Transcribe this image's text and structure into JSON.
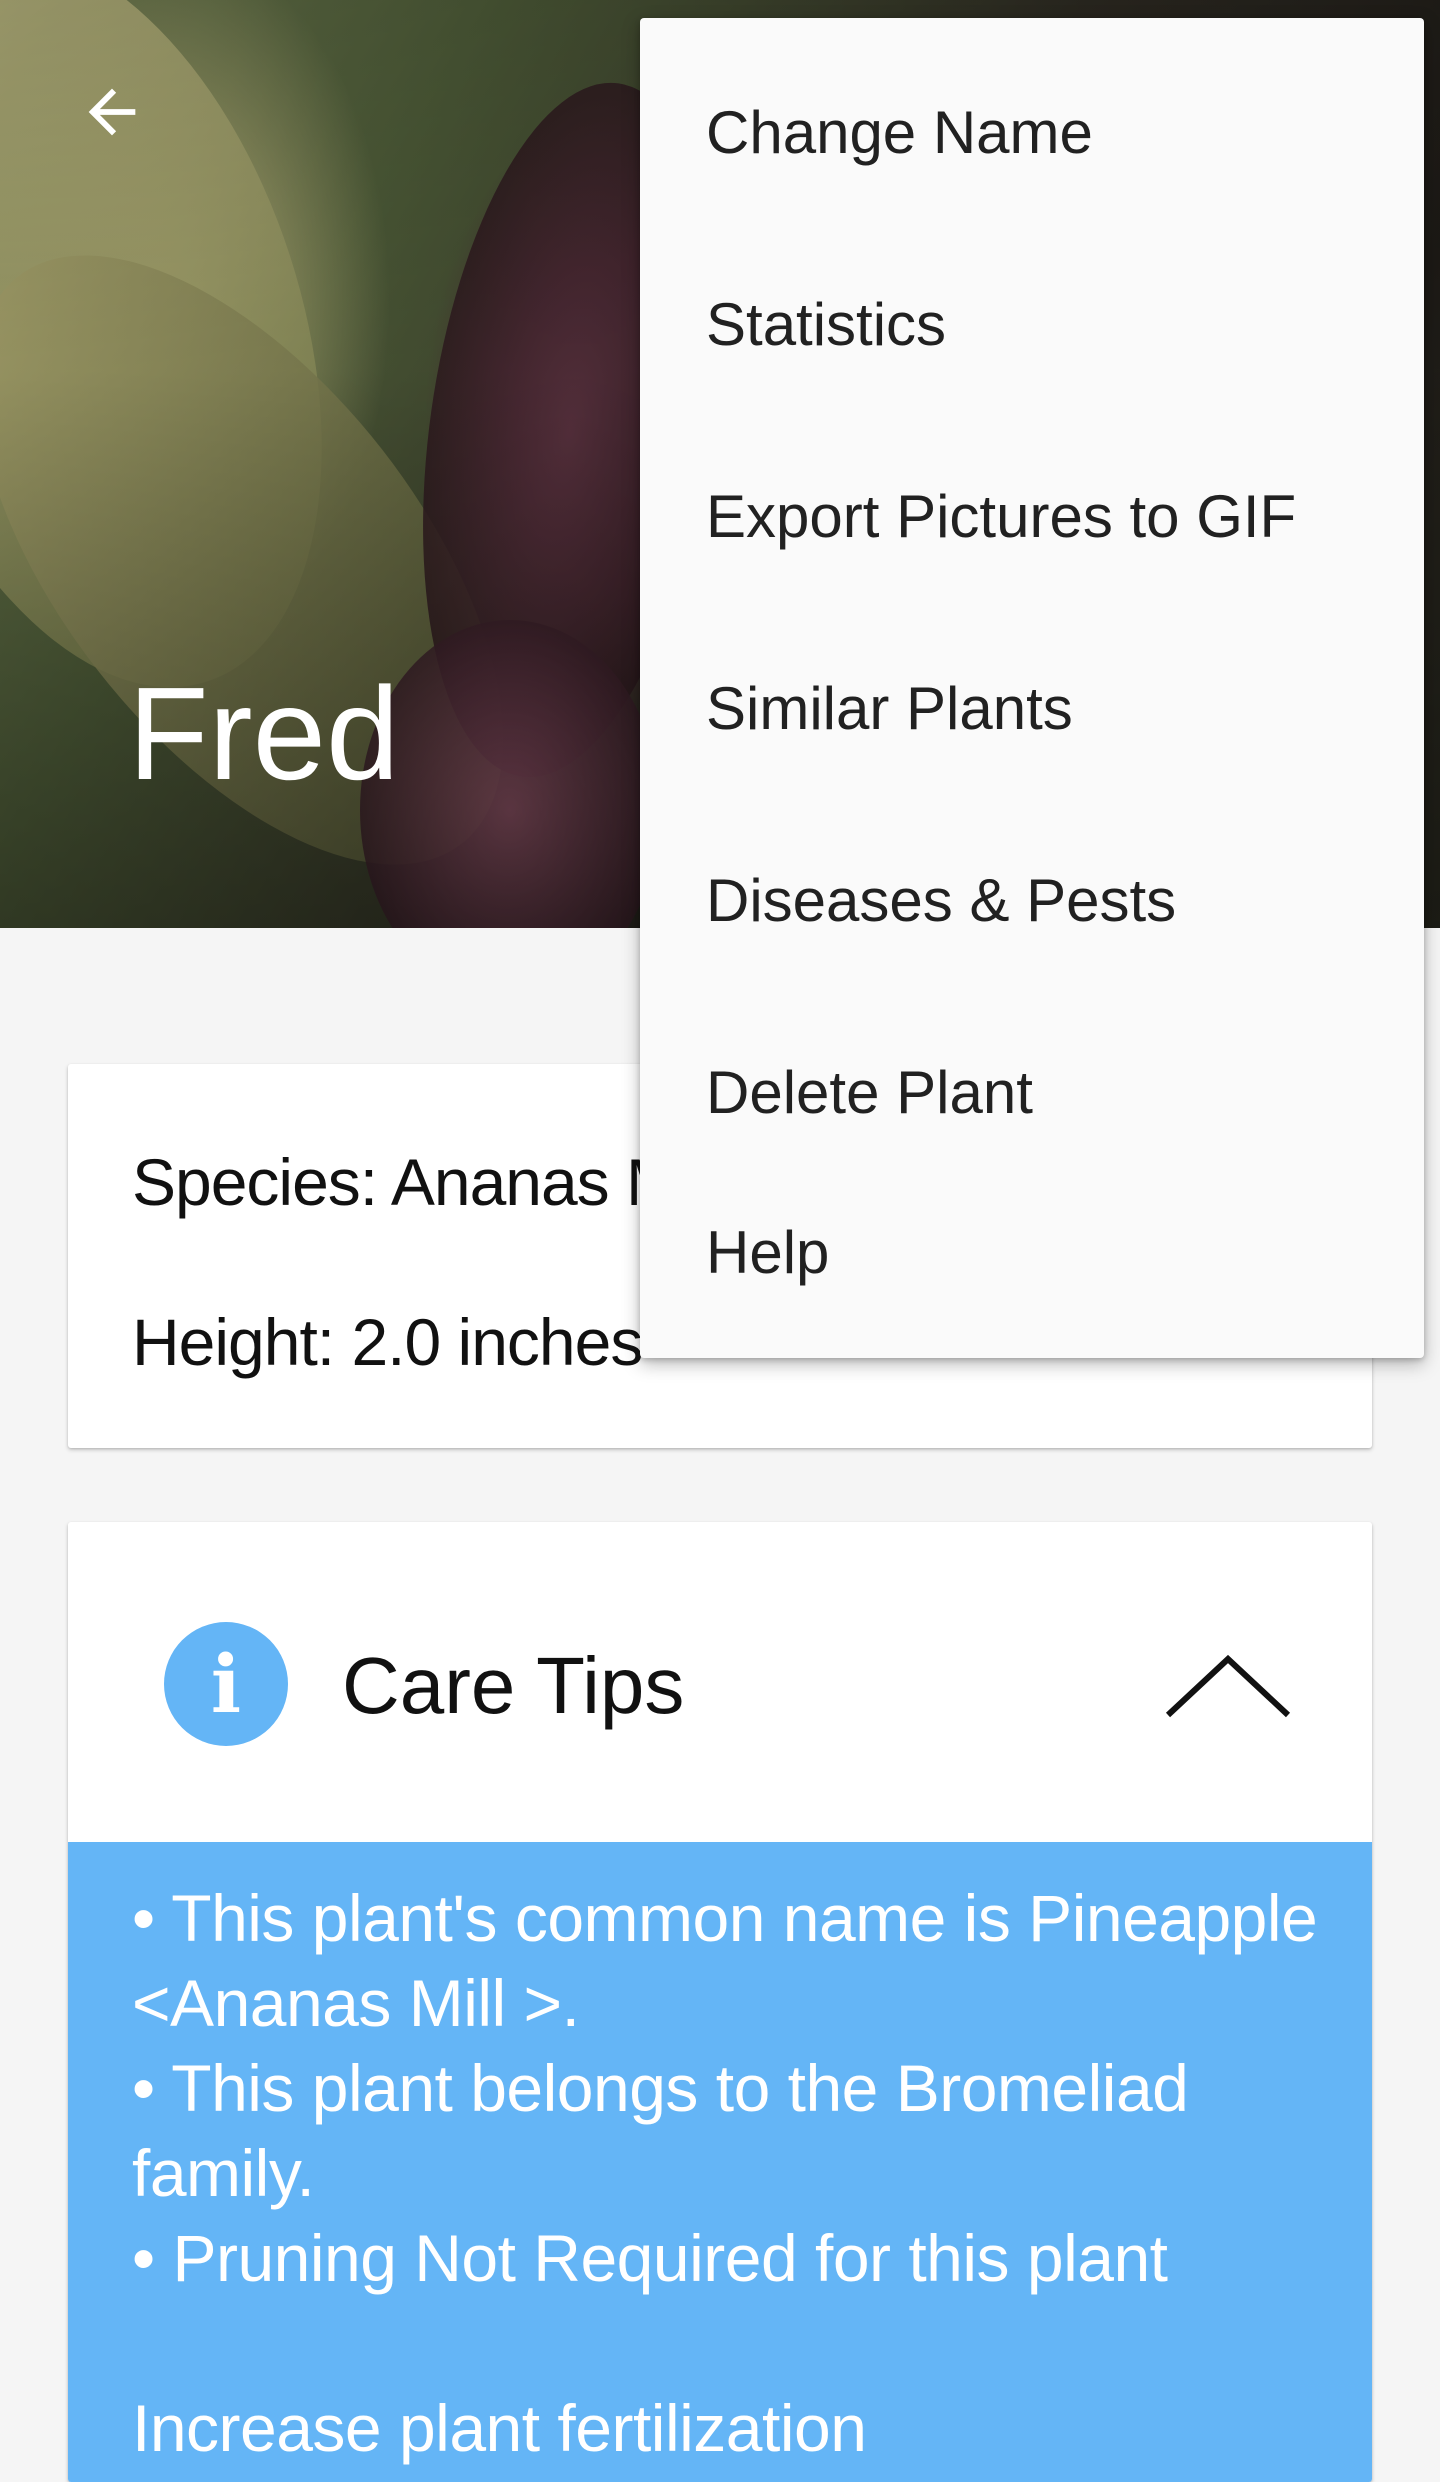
{
  "header": {
    "plant_name": "Fred"
  },
  "info": {
    "species": "Species: Ananas M",
    "height": "Height: 2.0 inches"
  },
  "care_tips": {
    "title": "Care Tips",
    "text": "• This plant's common name is Pineapple <Ananas Mill >.\n• This plant belongs to the Bromeliad family.\n• Pruning Not Required for this plant\n\nIncrease plant fertilization"
  },
  "menu": {
    "items": [
      "Change Name",
      "Statistics",
      "Export Pictures to GIF",
      "Similar Plants",
      "Diseases & Pests",
      "Delete Plant",
      "Help"
    ]
  },
  "colors": {
    "accent_blue": "#64b5f6",
    "menu_background": "#fafafa",
    "card_background": "#ffffff"
  },
  "icons": {
    "back": "arrow-left-icon",
    "info": "info-icon",
    "collapse": "chevron-up-icon"
  }
}
